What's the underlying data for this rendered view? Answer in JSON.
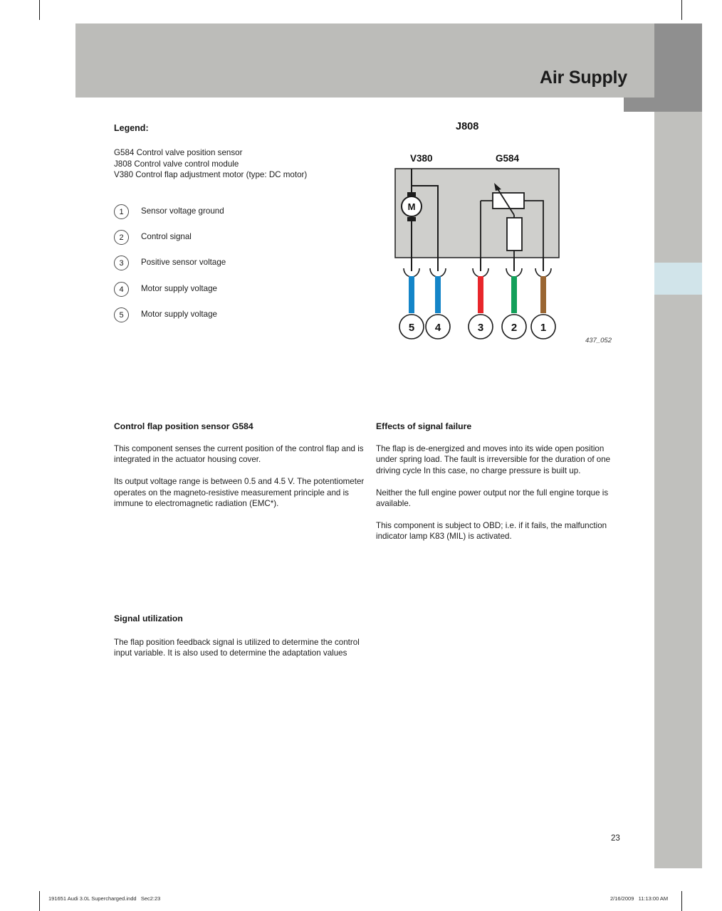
{
  "header": {
    "title": "Air Supply"
  },
  "legend": {
    "heading": "Legend:",
    "entries": "G584 Control valve position sensor\nJ808 Control valve control module\nV380 Control flap adjustment motor (type: DC motor)",
    "items": [
      {
        "number": "1",
        "label": "Sensor voltage ground"
      },
      {
        "number": "2",
        "label": "Control signal"
      },
      {
        "number": "3",
        "label": "Positive sensor voltage"
      },
      {
        "number": "4",
        "label": "Motor supply voltage"
      },
      {
        "number": "5",
        "label": "Motor supply voltage"
      }
    ]
  },
  "diagram": {
    "title": "J808",
    "label_motor": "V380",
    "label_sensor": "G584",
    "motor_symbol": "M",
    "caption": "437_052",
    "pins": [
      {
        "number": "5",
        "color": "#1485c8"
      },
      {
        "number": "4",
        "color": "#1485c8"
      },
      {
        "number": "3",
        "color": "#e8262b"
      },
      {
        "number": "2",
        "color": "#13a05a"
      },
      {
        "number": "1",
        "color": "#9a6633"
      }
    ]
  },
  "sections": {
    "sensor": {
      "heading": "Control flap position sensor G584",
      "paragraphs": [
        "This component senses the current position of the control flap and is integrated in the actuator housing cover.",
        "Its output voltage range is between 0.5 and 4.5 V. The potentiometer operates on the magneto-resistive measurement principle and is immune to electromagnetic radiation (EMC*)."
      ]
    },
    "effects": {
      "heading": "Effects of signal failure",
      "paragraphs": [
        "The flap is de-energized and moves into its wide open position under spring load. The fault is irreversible for the duration of one driving cycle  In this case, no charge pressure is built up.",
        "Neither the full engine power output nor the full engine torque is available.",
        "This component is subject to OBD; i.e. if it fails, the malfunction indicator lamp K83 (MIL) is activated."
      ]
    },
    "signal": {
      "heading": "Signal utilization",
      "paragraphs": [
        "The flap position feedback signal is utilized to determine the control input variable. It is also used to determine the adaptation values"
      ]
    }
  },
  "page_number": "23",
  "footer": {
    "left": "191651 Audi 3.0L Supercharged.indd   Sec2:23",
    "right": "2/16/2009   11:13:00 AM"
  }
}
